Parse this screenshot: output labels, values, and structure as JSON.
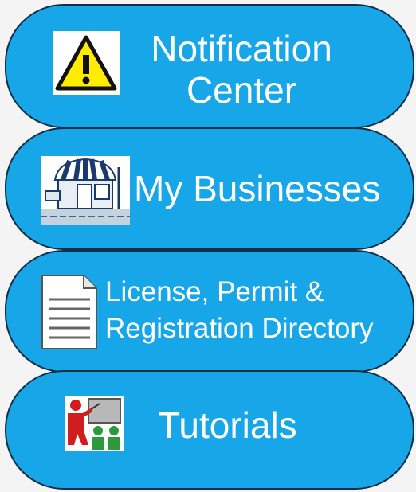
{
  "menu": {
    "items": [
      {
        "id": "notification-center",
        "label_line1": "Notification",
        "label_line2": "Center",
        "icon": "warning-icon"
      },
      {
        "id": "my-businesses",
        "label": "My Businesses",
        "icon": "storefront-icon"
      },
      {
        "id": "license-directory",
        "label_line1": "License, Permit &",
        "label_line2": "Registration Directory",
        "icon": "document-icon"
      },
      {
        "id": "tutorials",
        "label": "Tutorials",
        "icon": "presentation-icon"
      }
    ]
  },
  "colors": {
    "background": "#f4f4f4",
    "pill_fill": "#17a6e7",
    "pill_border": "#0e2f45",
    "text": "#ffffff"
  }
}
